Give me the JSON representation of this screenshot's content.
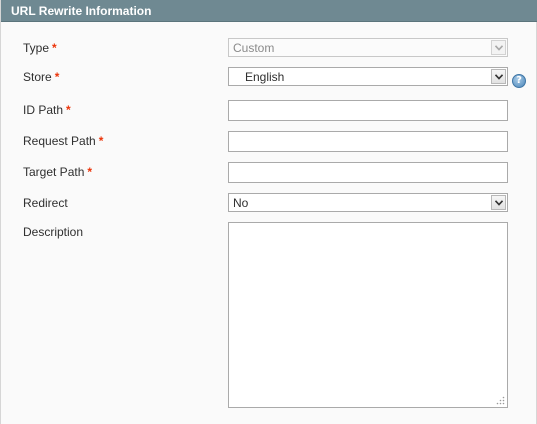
{
  "section": {
    "title": "URL Rewrite Information"
  },
  "form": {
    "type": {
      "label": "Type",
      "required_mark": "*",
      "value": "Custom"
    },
    "store": {
      "label": "Store",
      "required_mark": "*",
      "value": "English"
    },
    "id_path": {
      "label": "ID Path",
      "required_mark": "*",
      "value": ""
    },
    "request_path": {
      "label": "Request Path",
      "required_mark": "*",
      "value": ""
    },
    "target_path": {
      "label": "Target Path",
      "required_mark": "*",
      "value": ""
    },
    "redirect": {
      "label": "Redirect",
      "value": "No"
    },
    "description": {
      "label": "Description",
      "value": ""
    }
  },
  "icons": {
    "help": "help-icon",
    "select_arrow": "chevron-down-icon",
    "resize": "resize-grip-icon"
  },
  "colors": {
    "header_bg": "#6f8992",
    "required": "#eb340a",
    "help": "#4c86b8"
  }
}
